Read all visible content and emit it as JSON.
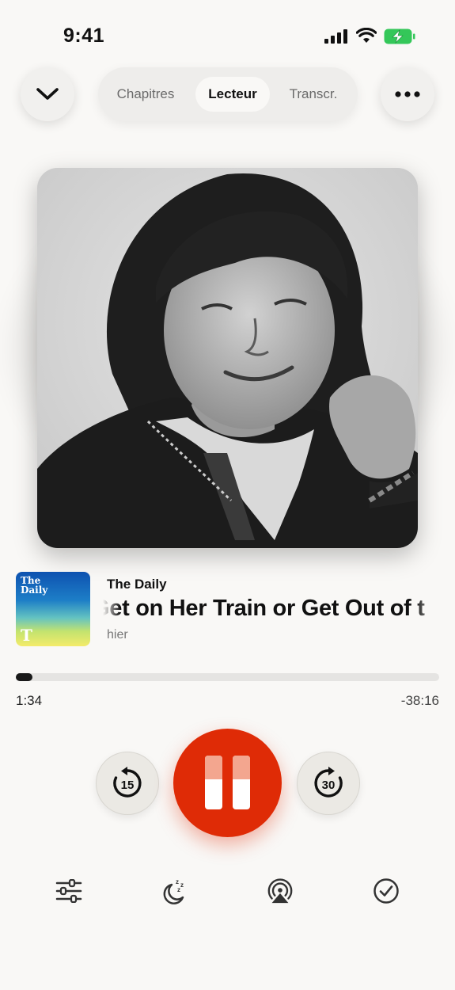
{
  "status_bar": {
    "time": "9:41"
  },
  "header": {
    "tabs": [
      {
        "label": "Chapitres",
        "active": false
      },
      {
        "label": "Lecteur",
        "active": true
      },
      {
        "label": "Transcr.",
        "active": false
      }
    ],
    "left_icon": "chevron-down-icon",
    "right_icon": "ellipsis-icon"
  },
  "now_playing": {
    "artwork_thumb_text": "The Daily",
    "artwork_thumb_logo": "T",
    "show": "The Daily",
    "episode_visible": "Get on Her Train or Get Out of t",
    "date": "hier"
  },
  "progress": {
    "elapsed": "1:34",
    "remaining": "-38:16",
    "fraction": 0.04
  },
  "controls": {
    "skip_back": "15",
    "skip_forward": "30",
    "state": "playing"
  },
  "bottom_icons": [
    "equalizer-sliders-icon",
    "sleep-timer-icon",
    "airplay-icon",
    "checkmark-circle-icon"
  ],
  "colors": {
    "accent": "#df2b06",
    "background": "#f9f8f6",
    "battery": "#34c759"
  }
}
